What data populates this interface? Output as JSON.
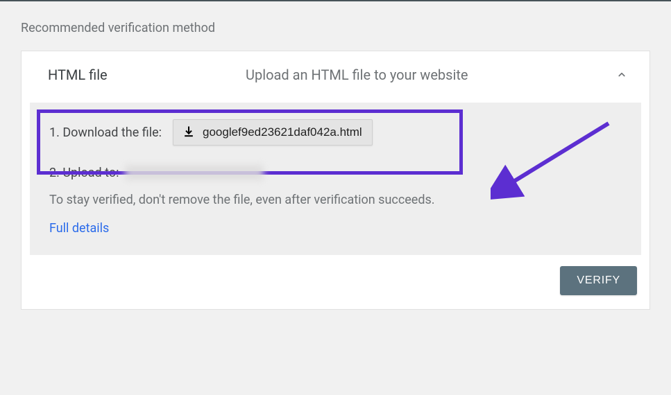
{
  "heading": "Recommended verification method",
  "card": {
    "title": "HTML file",
    "subtitle": "Upload an HTML file to your website"
  },
  "steps": {
    "download_label": "1. Download the file:",
    "download_filename": "googlef9ed23621daf042a.html",
    "upload_label": "2. Upload to:"
  },
  "note": "To stay verified, don't remove the file, even after verification succeeds.",
  "details_link": "Full details",
  "verify_button": "VERIFY",
  "colors": {
    "highlight": "#5c2ed1",
    "link": "#2b6bea",
    "verify_bg": "#5c727e"
  }
}
